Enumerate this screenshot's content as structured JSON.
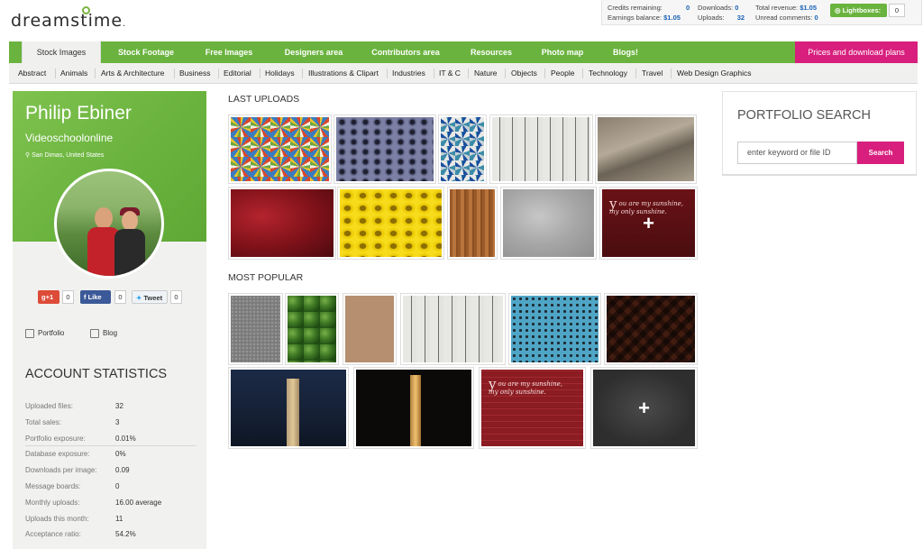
{
  "logo": {
    "text": "dreamstime",
    "suffix": "."
  },
  "account_bar": {
    "credits_label": "Credits remaining:",
    "credits_value": "0",
    "earnings_label": "Earnings balance:",
    "earnings_value": "$1.05",
    "downloads_label": "Downloads:",
    "downloads_value": "0",
    "uploads_label": "Uploads:",
    "uploads_value": "32",
    "revenue_label": "Total revenue:",
    "revenue_value": "$1.05",
    "comments_label": "Unread comments:",
    "comments_value": "0",
    "lightboxes_label": "Lightboxes:",
    "lightboxes_count": "0"
  },
  "main_nav": {
    "items": [
      "Stock Images",
      "Stock Footage",
      "Free Images",
      "Designers area",
      "Contributors area",
      "Resources",
      "Photo map",
      "Blogs!"
    ],
    "active": "Stock Images",
    "pricing_label": "Prices and download plans"
  },
  "sub_nav": {
    "items": [
      "Abstract",
      "Animals",
      "Arts & Architecture",
      "Business",
      "Editorial",
      "Holidays",
      "Illustrations & Clipart",
      "Industries",
      "IT & C",
      "Nature",
      "Objects",
      "People",
      "Technology",
      "Travel",
      "Web Design Graphics"
    ]
  },
  "profile": {
    "name": "Philip Ebiner",
    "username": "Videoschoolonline",
    "location": "San Dimas, United States"
  },
  "social": {
    "gplus_label": "g+1",
    "gplus_count": "0",
    "like_label": "Like",
    "like_count": "0",
    "tweet_label": "Tweet",
    "tweet_count": "0"
  },
  "links": {
    "portfolio": "Portfolio",
    "blog": "Blog"
  },
  "account_stats": {
    "title": "ACCOUNT STATISTICS",
    "rows": [
      {
        "label": "Uploaded files:",
        "value": "32"
      },
      {
        "label": "Total sales:",
        "value": "3"
      },
      {
        "label": "Portfolio exposure:",
        "value": "0.01%"
      },
      {
        "label": "Database exposure:",
        "value": "0%"
      },
      {
        "label": "Downloads per image:",
        "value": "0.09"
      },
      {
        "label": "Message boards:",
        "value": "0"
      },
      {
        "label": "Monthly uploads:",
        "value": "16.00 average"
      },
      {
        "label": "Uploads this month:",
        "value": "11"
      },
      {
        "label": "Acceptance ratio:",
        "value": "54.2%"
      }
    ]
  },
  "last_uploads": {
    "title": "LAST UPLOADS"
  },
  "most_popular": {
    "title": "MOST POPULAR"
  },
  "sunshine_text": {
    "letter": "y",
    "line1": "ou are my sunshine,",
    "line2": "my only sunshine."
  },
  "portfolio_search": {
    "title": "PORTFOLIO SEARCH",
    "placeholder": "enter keyword or file ID",
    "button_label": "Search"
  },
  "colors": {
    "brand_green": "#6ab33e",
    "accent_pink": "#d81f7d",
    "link_blue": "#1a63b5"
  }
}
